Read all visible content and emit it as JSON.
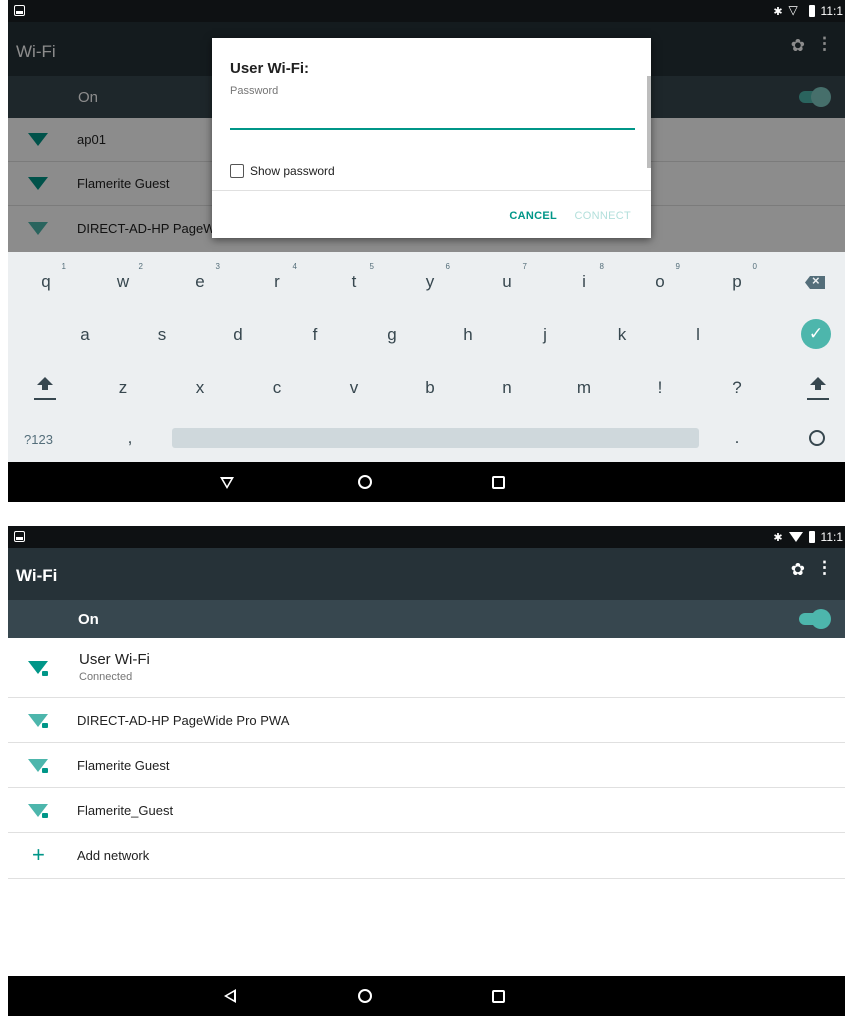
{
  "top": {
    "status": {
      "time": "11:1"
    },
    "appbar": {
      "title": "Wi-Fi"
    },
    "toggle": {
      "label": "On"
    },
    "networks": [
      {
        "name": "ap01"
      },
      {
        "name": "Flamerite Guest"
      },
      {
        "name": "DIRECT-AD-HP PageWide"
      }
    ],
    "dialog": {
      "title": "User Wi-Fi:",
      "password_label": "Password",
      "password_value": "",
      "show_password_label": "Show password",
      "cancel_label": "CANCEL",
      "connect_label": "CONNECT"
    },
    "keyboard": {
      "row1": [
        {
          "key": "q",
          "hint": "1"
        },
        {
          "key": "w",
          "hint": "2"
        },
        {
          "key": "e",
          "hint": "3"
        },
        {
          "key": "r",
          "hint": "4"
        },
        {
          "key": "t",
          "hint": "5"
        },
        {
          "key": "y",
          "hint": "6"
        },
        {
          "key": "u",
          "hint": "7"
        },
        {
          "key": "i",
          "hint": "8"
        },
        {
          "key": "o",
          "hint": "9"
        },
        {
          "key": "p",
          "hint": "0"
        }
      ],
      "row2": [
        "a",
        "s",
        "d",
        "f",
        "g",
        "h",
        "j",
        "k",
        "l"
      ],
      "row3": [
        "z",
        "x",
        "c",
        "v",
        "b",
        "n",
        "m",
        "!",
        "?"
      ],
      "symbols_label": "?123",
      "comma": ",",
      "period": "."
    }
  },
  "bottom": {
    "status": {
      "time": "11:1"
    },
    "appbar": {
      "title": "Wi-Fi"
    },
    "toggle": {
      "label": "On"
    },
    "networks": [
      {
        "name": "User Wi-Fi",
        "status": "Connected"
      },
      {
        "name": "DIRECT-AD-HP PageWide Pro PWA"
      },
      {
        "name": "Flamerite Guest"
      },
      {
        "name": "Flamerite_Guest"
      }
    ],
    "add_network_label": "Add network"
  },
  "colors": {
    "accent": "#009688",
    "appbar": "#263238",
    "toggle_bar": "#37474f"
  }
}
